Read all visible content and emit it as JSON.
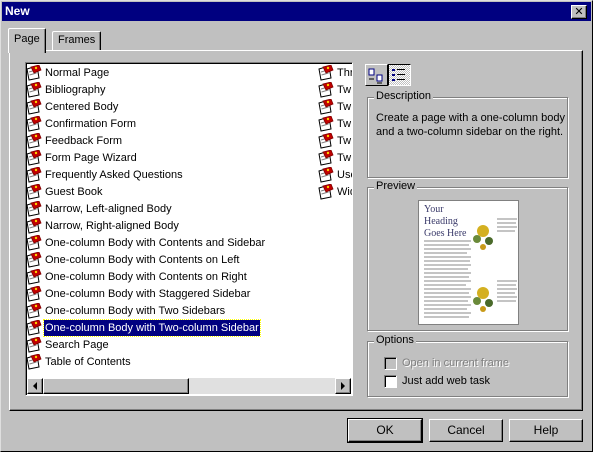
{
  "window": {
    "title": "New",
    "close_glyph": "✕"
  },
  "tabs": [
    {
      "label": "Page",
      "active": true
    },
    {
      "label": "Frames",
      "active": false
    }
  ],
  "templates": {
    "column1": [
      "Normal Page",
      "Bibliography",
      "Centered Body",
      "Confirmation Form",
      "Feedback Form",
      "Form Page Wizard",
      "Frequently Asked Questions",
      "Guest Book",
      "Narrow, Left-aligned Body",
      "Narrow, Right-aligned Body",
      "One-column Body with Contents and Sidebar",
      "One-column Body with Contents on Left",
      "One-column Body with Contents on Right",
      "One-column Body with Staggered Sidebar",
      "One-column Body with Two Sidebars",
      "One-column Body with Two-column Sidebar",
      "Search Page",
      "Table of Contents"
    ],
    "column2": [
      "Thr",
      "Tw",
      "Tw",
      "Tw",
      "Tw",
      "Tw",
      "Use",
      "Wid"
    ],
    "selected_index": 15,
    "icon": "page-template-icon"
  },
  "view_buttons": [
    {
      "name": "large-icons-view-icon",
      "pressed": false
    },
    {
      "name": "details-list-view-icon",
      "pressed": true
    }
  ],
  "description": {
    "label": "Description",
    "text": "Create a page with a one-column body and a two-column sidebar on the right."
  },
  "preview": {
    "label": "Preview",
    "heading": "Your Heading Goes Here"
  },
  "options": {
    "label": "Options",
    "open_in_current_frame": {
      "label": "Open in current frame",
      "checked": false,
      "enabled": false
    },
    "just_add_web_task": {
      "label": "Just add web task",
      "checked": false,
      "enabled": true
    }
  },
  "buttons": {
    "ok": "OK",
    "cancel": "Cancel",
    "help": "Help"
  },
  "colors": {
    "face": "#c0c0c0",
    "title_bar": "#000080",
    "selection": "#000080"
  }
}
